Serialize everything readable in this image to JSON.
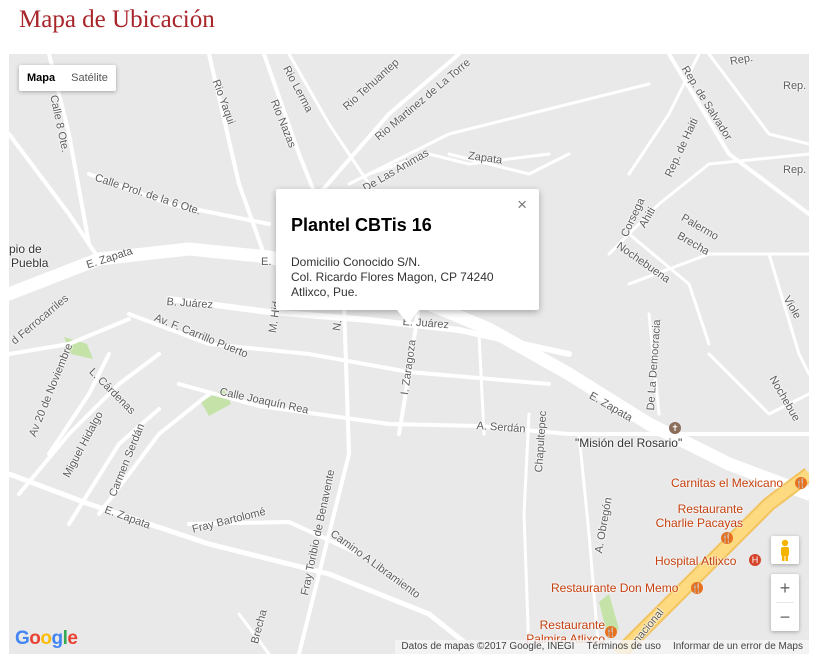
{
  "page_title": "Mapa de Ubicación",
  "map_type": {
    "map": "Mapa",
    "satellite": "Satélite",
    "selected": "Mapa"
  },
  "info_window": {
    "title": "Plantel CBTis 16",
    "line1": "Domicilio Conocido S/N.",
    "line2": "Col. Ricardo Flores Magon, CP 74240",
    "line3": "Atlixco, Pue.",
    "close": "×"
  },
  "streets": {
    "rio_lerma": "Rio Lerma",
    "rio_yaqui": "Rio Yaqui",
    "rio_nazas": "Rio Nazas",
    "rio_tehuantep": "Rio Tehuantep",
    "rio_martinez": "Rio Martinez de La Torre",
    "de_las_animas": "De Las Animas",
    "zapata_top": "Zapata",
    "rep_salvador": "Rep. de Salvador",
    "rep_top": "Rep.",
    "rep_right1": "Rep.",
    "rep_right2": "Rep.",
    "rep_haiti": "Rep. de Haiti",
    "corsega": "Corsega",
    "ahiti": "Ahiti",
    "palermo": "Palermo",
    "brecha_top": "Brecha",
    "nochebuena": "Nochebuena",
    "nochebuena_right": "Nochebue",
    "violetas": "Viole",
    "calle_8_ote": "Calle 8 Ote.",
    "calle_prol_6": "Calle Prol. de la 6 Ote.",
    "pio_de": "pio de",
    "puebla": "Puebla",
    "e_zapata_left": "E. Zapata",
    "e_mid": "E.",
    "ferrocarriles": "d Ferrocarriles",
    "b_juarez": "B. Juárez",
    "e_juarez": "E. Juárez",
    "av_carrillo": "Av. F. Carrillo Puerto",
    "m_hid": "M. Hid",
    "n_st": "N.",
    "l_cardenas": "L. Cárdenas",
    "av_20_nov": "Av 20 de Noviembre",
    "calle_joaquin_rea": "Calle Joaquín Rea",
    "miguel_hidalgo": "Miguel Hidalgo",
    "carmen_serdan": "Carmen Serdán",
    "i_zaragoza": "I. Zaragoza",
    "a_serdan": "A. Serdán",
    "chapultepec": "Chapultepec",
    "de_la_democracia": "De La Democracia",
    "e_zapata_right": "E. Zapata",
    "e_zapata_bottom": "E. Zapata",
    "fray_bartolome": "Fray Bartolomé",
    "fray_toribio": "Fray Toribio de Benavente",
    "camino_libramiento": "Camino A Libramiento",
    "a_obregon": "A. Obregón",
    "brecha_bottom": "Brecha",
    "nacional": "nacional"
  },
  "pois": {
    "mision_rosario": "\"Misión del Rosario\"",
    "carnitas": "Carnitas el Mexicano",
    "charlie_1": "Restaurante",
    "charlie_2": "Charlie Pacayas",
    "hospital": "Hospital Atlixco",
    "don_memo": "Restaurante Don Memo",
    "palmira_1": "Restaurante",
    "palmira_2": "Palmira Atlixco"
  },
  "controls": {
    "zoom_in": "+",
    "zoom_out": "−"
  },
  "google_logo": "Google",
  "attribution": {
    "data": "Datos de mapas ©2017 Google, INEGI",
    "terms": "Términos de uso",
    "report": "Informar de un error de Maps"
  },
  "colors": {
    "title": "#a8252a",
    "map_bg": "#e9e9e9",
    "road": "#ffffff",
    "highway": "#fdd980",
    "park": "#c5e3a8",
    "poi": "#c5410f"
  }
}
